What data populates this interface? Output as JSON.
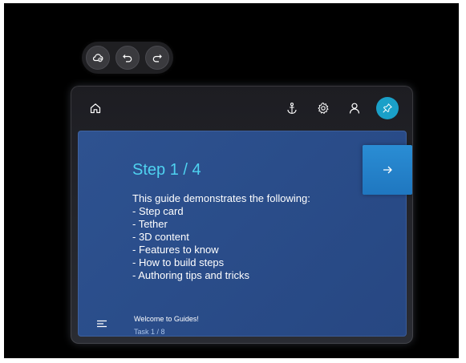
{
  "toolbar": {
    "icons": [
      "cloud-sync-icon",
      "undo-icon",
      "redo-icon"
    ]
  },
  "topbar": {
    "icons": [
      "home-icon",
      "anchor-icon",
      "settings-icon",
      "user-icon",
      "pin-icon"
    ],
    "accent": "#1aa0c8"
  },
  "card": {
    "title": "Step 1 / 4",
    "lines": [
      "This guide demonstrates the following:",
      "- Step card",
      "- Tether",
      "- 3D content",
      "- Features to know",
      "- How to build steps",
      "- Authoring tips and tricks"
    ],
    "footer_title": "Welcome to Guides!",
    "footer_sub": "Task 1 / 8",
    "title_color": "#4fd2f0",
    "background": "#2b4e8c"
  },
  "next_button": {
    "icon": "arrow-right-icon",
    "color": "#1f80c8"
  }
}
